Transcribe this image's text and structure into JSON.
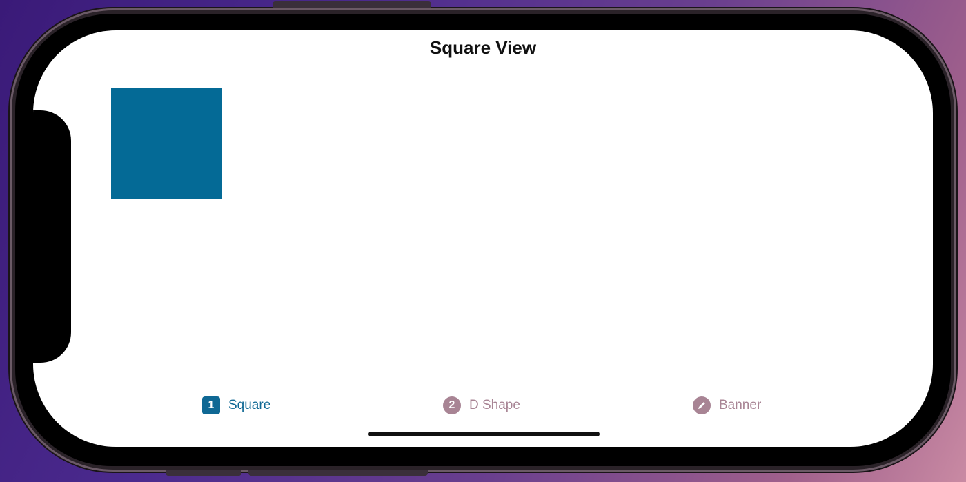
{
  "nav": {
    "title": "Square View"
  },
  "content": {
    "square_color": "#046a96"
  },
  "tabbar": {
    "active_color": "#0f6894",
    "inactive_color": "#a88494",
    "tabs": [
      {
        "badge": "1",
        "label": "Square",
        "icon": "number-1-square-icon",
        "selected": true
      },
      {
        "badge": "2",
        "label": "D Shape",
        "icon": "number-2-circle-icon",
        "selected": false
      },
      {
        "badge": "",
        "label": "Banner",
        "icon": "pencil-circle-icon",
        "selected": false
      }
    ]
  }
}
